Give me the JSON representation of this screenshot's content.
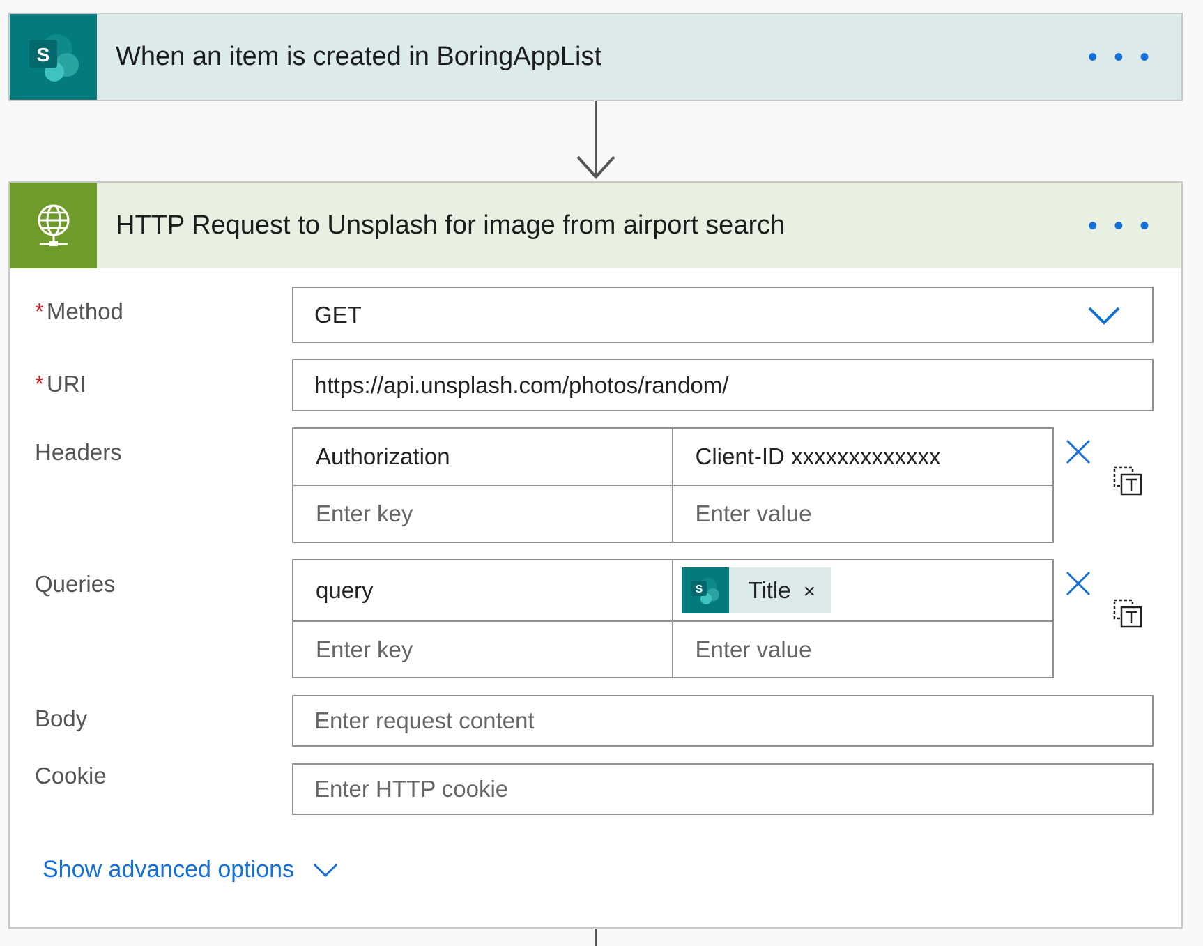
{
  "trigger": {
    "title": "When an item is created in BoringAppList",
    "icon": "sharepoint-icon",
    "more": "• • •"
  },
  "action": {
    "title": "HTTP Request to Unsplash for image from airport search",
    "icon": "globe-icon",
    "more": "• • •"
  },
  "fields": {
    "method": {
      "label": "Method",
      "required": "*",
      "value": "GET"
    },
    "uri": {
      "label": "URI",
      "required": "*",
      "value": "https://api.unsplash.com/photos/random/"
    },
    "headers": {
      "label": "Headers",
      "key": "Authorization",
      "value": "Client-ID xxxxxxxxxxxxx",
      "key_placeholder": "Enter key",
      "value_placeholder": "Enter value"
    },
    "queries": {
      "label": "Queries",
      "key": "query",
      "token_label": "Title",
      "token_remove": "×",
      "key_placeholder": "Enter key",
      "value_placeholder": "Enter value"
    },
    "body": {
      "label": "Body",
      "placeholder": "Enter request content"
    },
    "cookie": {
      "label": "Cookie",
      "placeholder": "Enter HTTP cookie"
    }
  },
  "advanced": {
    "label": "Show advanced options"
  },
  "colors": {
    "sharepoint": "#037a7d",
    "http": "#6f9b2a",
    "accent": "#1470d6",
    "required": "#c4262e"
  }
}
